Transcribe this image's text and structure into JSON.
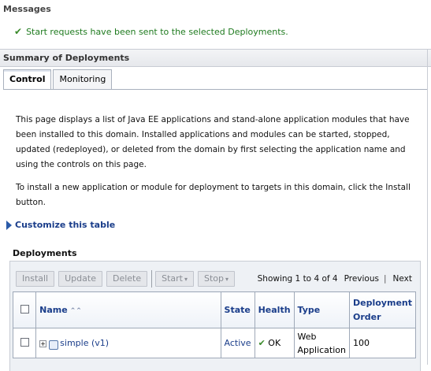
{
  "messages": {
    "title": "Messages",
    "success": "Start requests have been sent to the selected Deployments."
  },
  "summary": {
    "title": "Summary of Deployments",
    "tabs": [
      {
        "label": "Control",
        "active": true
      },
      {
        "label": "Monitoring",
        "active": false
      }
    ],
    "description": "This page displays a list of Java EE applications and stand-alone application modules that have been installed to this domain. Installed applications and modules can be started, stopped, updated (redeployed), or deleted from the domain by first selecting the application name and using the controls on this page.",
    "install_hint": "To install a new application or module for deployment to targets in this domain, click the Install button.",
    "customize_label": "Customize this table"
  },
  "deployments": {
    "title": "Deployments",
    "toolbar": {
      "install": "Install",
      "update": "Update",
      "delete": "Delete",
      "start": "Start",
      "stop": "Stop"
    },
    "pagination": {
      "showing": "Showing 1 to 4 of 4",
      "previous": "Previous",
      "next": "Next"
    },
    "columns": {
      "name": "Name",
      "state": "State",
      "health": "Health",
      "type": "Type",
      "deployment_order": "Deployment Order"
    },
    "rows": [
      {
        "name": "simple (v1)",
        "state": "Active",
        "health": "OK",
        "type": "Web Application",
        "deployment_order": "100"
      }
    ]
  }
}
